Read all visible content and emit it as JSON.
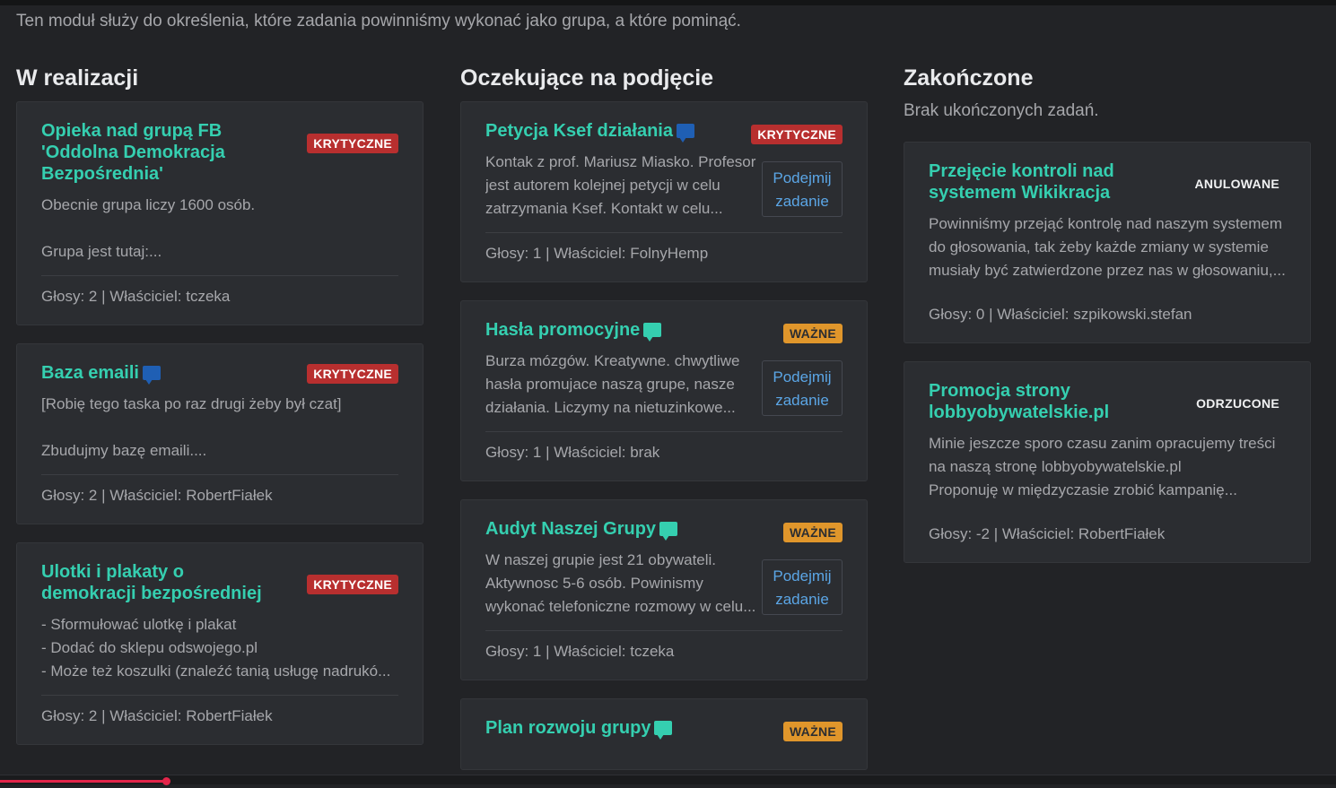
{
  "intro": "Ten moduł służy do określenia, które zadania powinniśmy wykonać jako grupa, a które pominąć.",
  "take_label_1": "Podejmij",
  "take_label_2": "zadanie",
  "colors": {
    "accent": "#35cfb0",
    "critical": "#b82f2f",
    "important": "#e0962b",
    "link": "#5ba6e6"
  },
  "columns": [
    {
      "title": "W realizacji",
      "cards": [
        {
          "title": "Opieka nad grupą FB 'Oddolna Demokracja Bezpośrednia'",
          "badge": "KRYTYCZNE",
          "lines": [
            "Obecnie grupa liczy 1600 osób.",
            "",
            "Grupa jest tutaj:..."
          ],
          "footer": "Głosy: 2 | Właściciel: tczeka"
        },
        {
          "title": "Baza emaili",
          "badge": "KRYTYCZNE",
          "icon": "chat-icon",
          "lines": [
            "[Robię tego taska po raz drugi żeby był czat]",
            "",
            "Zbudujmy bazę emaili...."
          ],
          "footer": "Głosy: 2 | Właściciel: RobertFiałek"
        },
        {
          "title": "Ulotki i plakaty o demokracji bezpośredniej",
          "badge": "KRYTYCZNE",
          "lines": [
            "- Sformułować ulotkę i plakat",
            "- Dodać do sklepu odswojego.pl",
            "- Może też koszulki (znaleźć tanią usługę nadrukó..."
          ],
          "footer": "Głosy: 2 | Właściciel: RobertFiałek"
        }
      ]
    },
    {
      "title": "Oczekujące na podjęcie",
      "cards": [
        {
          "title": "Petycja Ksef działania",
          "badge": "KRYTYCZNE",
          "icon": "chat-icon",
          "lines": [
            "Kontak z prof. Mariusz Miasko. Profesor",
            "jest autorem kolejnej petycji w celu",
            "zatrzymania Ksef. Kontakt w celu..."
          ],
          "footer": "Głosy: 1 | Właściciel: FolnyHemp"
        },
        {
          "title": "Hasła promocyjne",
          "badge": "WAŻNE",
          "icon": "chat-icon",
          "lines": [
            "Burza mózgów. Kreatywne. chwytliwe",
            "hasła promujace naszą grupe, nasze",
            "działania. Liczymy na nietuzinkowe..."
          ],
          "footer": "Głosy: 1 | Właściciel: brak"
        },
        {
          "title": "Audyt Naszej Grupy",
          "badge": "WAŻNE",
          "icon": "chat-icon",
          "lines": [
            "W naszej grupie jest 21 obywateli.",
            "Aktywnosc 5-6 osób. Powinismy",
            "wykonać telefoniczne rozmowy w celu..."
          ],
          "footer": "Głosy: 1 | Właściciel: tczeka"
        },
        {
          "title": "Plan rozwoju grupy",
          "badge": "WAŻNE",
          "icon": "chat-icon",
          "lines": [],
          "footer": ""
        }
      ]
    },
    {
      "title": "Zakończone",
      "empty_note": "Brak ukończonych zadań.",
      "cards": [
        {
          "title": "Przejęcie kontroli nad systemem Wikikracja",
          "badge": "ANULOWANE",
          "lines": [
            "Powinniśmy przejąć kontrolę nad naszym systemem",
            "do głosowania, tak żeby każde zmiany w systemie",
            "musiały być zatwierdzone przez nas w głosowaniu,..."
          ],
          "footer": "Głosy: 0 | Właściciel: szpikowski.stefan"
        },
        {
          "title": "Promocja strony lobbyobywatelskie.pl",
          "badge": "ODRZUCONE",
          "lines": [
            "Minie jeszcze sporo czasu zanim opracujemy treści",
            "na naszą stronę lobbyobywatelskie.pl",
            "Proponuję w międzyczasie zrobić kampanię..."
          ],
          "footer": "Głosy: -2 | Właściciel: RobertFiałek"
        }
      ]
    }
  ],
  "video_progress": 0.125
}
